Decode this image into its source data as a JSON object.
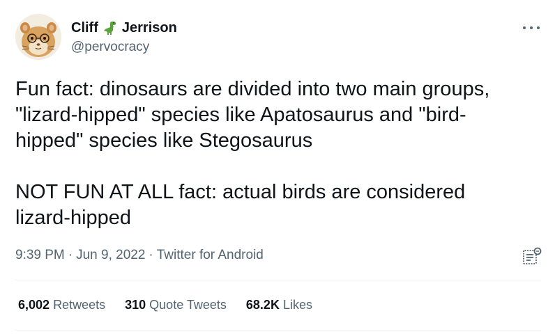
{
  "author": {
    "name_first": "Cliff",
    "name_last": "Jerrison",
    "name_emoji_icon": "t-rex-dinosaur-emoji",
    "handle": "@pervocracy",
    "avatar_icon": "hamster-with-glasses-avatar"
  },
  "tweet": {
    "paragraph_1": "Fun fact: dinosaurs are divided into two main groups,\n\"lizard-hipped\" species like Apatosaurus and \"bird-\nhipped\" species like Stegosaurus",
    "paragraph_2": "NOT FUN AT ALL fact: actual birds are considered\nlizard-hipped"
  },
  "meta": {
    "time": "9:39 PM",
    "separator": "·",
    "date": "Jun 9, 2022",
    "source": "Twitter for Android"
  },
  "stats": {
    "retweets_count": "6,002",
    "retweets_label": "Retweets",
    "quotes_count": "310",
    "quotes_label": "Quote Tweets",
    "likes_count": "68.2K",
    "likes_label": "Likes"
  },
  "icons": {
    "more": "more-horizontal-icon",
    "analytics": "analytics-icon"
  },
  "colors": {
    "text": "#0f1419",
    "secondary": "#536471",
    "divider": "#eff3f4",
    "dino_green": "#5aa33b"
  }
}
